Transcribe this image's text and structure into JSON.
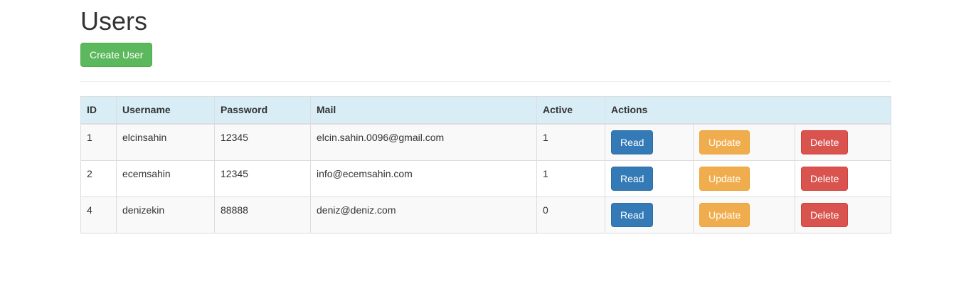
{
  "page": {
    "title": "Users"
  },
  "toolbar": {
    "create_label": "Create User"
  },
  "table": {
    "headers": {
      "id": "ID",
      "username": "Username",
      "password": "Password",
      "mail": "Mail",
      "active": "Active",
      "actions": "Actions"
    },
    "rows": [
      {
        "id": "1",
        "username": "elcinsahin",
        "password": "12345",
        "mail": "elcin.sahin.0096@gmail.com",
        "active": "1"
      },
      {
        "id": "2",
        "username": "ecemsahin",
        "password": "12345",
        "mail": "info@ecemsahin.com",
        "active": "1"
      },
      {
        "id": "4",
        "username": "denizekin",
        "password": "88888",
        "mail": "deniz@deniz.com",
        "active": "0"
      }
    ],
    "actions": {
      "read": "Read",
      "update": "Update",
      "delete": "Delete"
    }
  },
  "colors": {
    "success": "#5cb85c",
    "primary": "#337ab7",
    "warning": "#f0ad4e",
    "danger": "#d9534f",
    "header_bg": "#d9edf7"
  }
}
